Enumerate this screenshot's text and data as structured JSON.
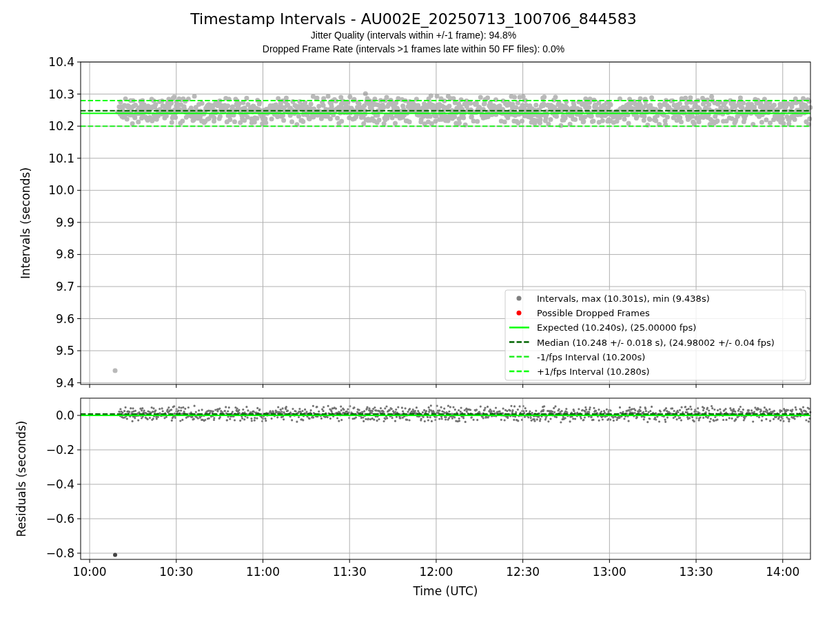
{
  "figure": {
    "title": "Timestamp Intervals - AU002E_20250713_100706_844583",
    "subtitles": [
      "Jitter Quality (intervals within +/-1 frame): 94.8%",
      "Dropped Frame Rate (intervals >1 frames late within 50 FF files): 0.0%"
    ]
  },
  "intervals_panel": {
    "chart_data": {
      "type": "scatter",
      "ylabel": "Intervals (seconds)",
      "grid": true,
      "legend": "lower right",
      "xlim": [
        9.948,
        14.16
      ],
      "ylim": [
        9.395,
        10.4
      ],
      "yticks": [
        {
          "value": 9.4,
          "label": "9.4"
        },
        {
          "value": 9.5,
          "label": "9.5"
        },
        {
          "value": 9.6,
          "label": "9.6"
        },
        {
          "value": 9.7,
          "label": "9.7"
        },
        {
          "value": 9.8,
          "label": "9.8"
        },
        {
          "value": 9.9,
          "label": "9.9"
        },
        {
          "value": 10,
          "label": "10.0"
        },
        {
          "value": 10.1,
          "label": "10.1"
        },
        {
          "value": 10.2,
          "label": "10.2"
        },
        {
          "value": 10.3,
          "label": "10.3"
        },
        {
          "value": 10.4,
          "label": "10.4"
        }
      ],
      "series": [
        {
          "name": "Intervals, max (10.301s), min (9.438s)",
          "color": "#808080",
          "x": [
            10.147,
            11.592
          ],
          "values": [
            9.438,
            10.301
          ]
        },
        {
          "name": "Possible Dropped Frames",
          "color": "#ff0000",
          "x": [
            null
          ],
          "values": [
            null
          ]
        }
      ],
      "ref_lines": [
        {
          "axis": "y",
          "value": 10.24,
          "label": "Expected (10.240s), (25.00000 fps)",
          "color": "#00ff00"
        },
        {
          "axis": "y",
          "value": 10.248,
          "label": "Median (10.248 +/- 0.018 s), (24.98002 +/- 0.04 fps)",
          "color": "#006400"
        },
        {
          "axis": "y",
          "value": 10.2,
          "label": "-1/fps Interval (10.200s)",
          "color": "#22ee22"
        },
        {
          "axis": "y",
          "value": 10.28,
          "label": "+1/fps Interval (10.280s)",
          "color": "#00ff00"
        }
      ]
    }
  },
  "residuals_panel": {
    "chart_data": {
      "type": "scatter",
      "xlabel": "Time (UTC)",
      "ylabel": "Residuals (seconds)",
      "grid": true,
      "xlim": [
        9.948,
        14.16
      ],
      "ylim": [
        -0.836,
        0.1
      ],
      "xticks": [
        {
          "value": 10,
          "label": "10:00"
        },
        {
          "value": 10.5,
          "label": "10:30"
        },
        {
          "value": 11,
          "label": "11:00"
        },
        {
          "value": 11.5,
          "label": "11:30"
        },
        {
          "value": 12,
          "label": "12:00"
        },
        {
          "value": 12.5,
          "label": "12:30"
        },
        {
          "value": 13,
          "label": "13:00"
        },
        {
          "value": 13.5,
          "label": "13:30"
        },
        {
          "value": 14,
          "label": "14:00"
        }
      ],
      "yticks": [
        {
          "value": -0.8,
          "label": "−0.8"
        },
        {
          "value": -0.6,
          "label": "−0.6"
        },
        {
          "value": -0.4,
          "label": "−0.4"
        },
        {
          "value": -0.2,
          "label": "−0.2"
        },
        {
          "value": 0,
          "label": "0.0"
        }
      ],
      "series": [
        {
          "color": "#444444",
          "x": [
            10.147
          ],
          "values": [
            -0.81
          ]
        }
      ],
      "ref_lines": [
        {
          "axis": "y",
          "value": 0,
          "color": "#00ff00"
        },
        {
          "axis": "y",
          "value": 0.008,
          "color": "#006400"
        }
      ]
    }
  }
}
